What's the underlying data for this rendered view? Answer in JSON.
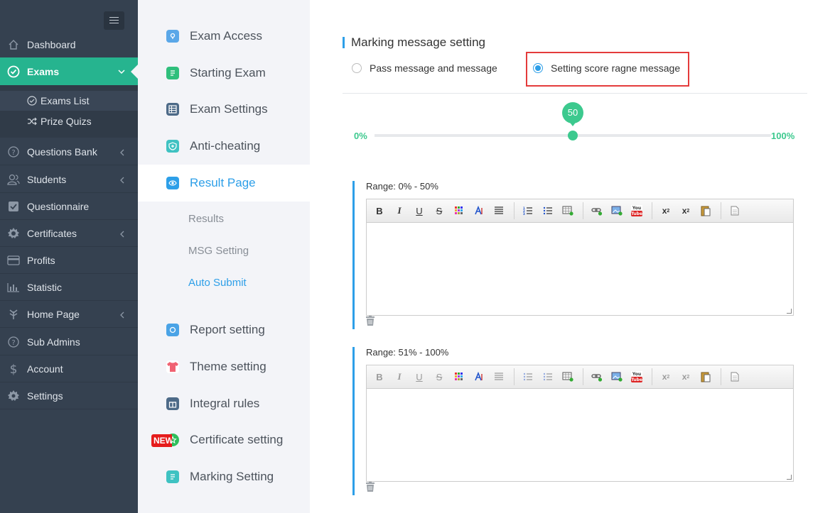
{
  "sidebar": {
    "items": [
      {
        "label": "Dashboard",
        "icon": "home-icon"
      },
      {
        "label": "Exams",
        "icon": "check-circle-icon"
      },
      {
        "label": "Questions Bank",
        "icon": "question-circle-icon"
      },
      {
        "label": "Students",
        "icon": "users-icon"
      },
      {
        "label": "Questionnaire",
        "icon": "checkbox-icon"
      },
      {
        "label": "Certificates",
        "icon": "gear-badge-icon"
      },
      {
        "label": "Profits",
        "icon": "card-icon"
      },
      {
        "label": "Statistic",
        "icon": "bar-chart-icon"
      },
      {
        "label": "Home Page",
        "icon": "leaf-icon"
      },
      {
        "label": "Sub Admins",
        "icon": "question-circle-icon"
      },
      {
        "label": "Account",
        "icon": "dollar-icon"
      },
      {
        "label": "Settings",
        "icon": "gear-icon"
      }
    ],
    "sub_items": [
      {
        "label": "Exams List",
        "icon": "check-circle-icon"
      },
      {
        "label": "Prize Quizs",
        "icon": "shuffle-icon"
      }
    ]
  },
  "settings_nav": {
    "items": [
      {
        "label": "Exam Access",
        "color": "#5aa7e8"
      },
      {
        "label": "Starting Exam",
        "color": "#2fbf7c"
      },
      {
        "label": "Exam Settings",
        "color": "#4d6a88"
      },
      {
        "label": "Anti-cheating",
        "color": "#3fc2c2"
      },
      {
        "label": "Result Page",
        "color": "#2d9fe8"
      },
      {
        "label": "Report setting",
        "color": "#4aa3e6"
      },
      {
        "label": "Theme setting",
        "color": "#f06272"
      },
      {
        "label": "Integral rules",
        "color": "#4d6a88"
      },
      {
        "label": "Certificate setting",
        "color": "#2fbf5c"
      },
      {
        "label": "Marking Setting",
        "color": "#3fc2c2"
      }
    ],
    "result_sub": [
      "Results",
      "MSG Setting",
      "Auto Submit"
    ],
    "new_badge": "NEW"
  },
  "main": {
    "section_title": "Marking message setting",
    "radio_pass": "Pass message and message",
    "radio_range": "Setting score ragne message",
    "slider": {
      "min_label": "0%",
      "max_label": "100%",
      "value": 50,
      "value_label": "50"
    },
    "editors": [
      {
        "range_label": "Range: 0% - 50%",
        "enabled": true
      },
      {
        "range_label": "Range: 51% - 100%",
        "enabled": false
      }
    ]
  },
  "colors": {
    "accent": "#26b48f",
    "blue": "#2d9fe8",
    "slider": "#3cc98e",
    "highlight": "#e43b3b"
  }
}
